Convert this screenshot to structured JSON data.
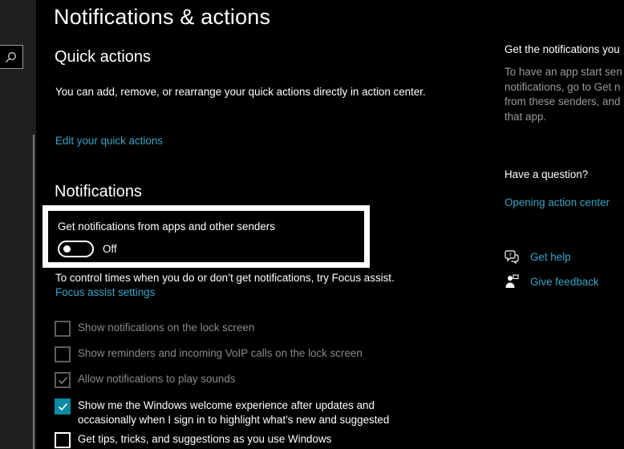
{
  "page_title": "Notifications & actions",
  "quick_actions": {
    "heading": "Quick actions",
    "description": "You can add, remove, or rearrange your quick actions directly in action center.",
    "edit_link": "Edit your quick actions"
  },
  "notifications": {
    "heading": "Notifications",
    "toggle_label": "Get notifications from apps and other senders",
    "toggle_state": "Off",
    "focus_text": "To control times when you do or don’t get notifications, try Focus assist.",
    "focus_link": "Focus assist settings",
    "options": [
      {
        "label": "Show notifications on the lock screen",
        "checked": false
      },
      {
        "label": "Show reminders and incoming VoIP calls on the lock screen",
        "checked": false
      },
      {
        "label": "Allow notifications to play sounds",
        "checked": true
      },
      {
        "label": "Show me the Windows welcome experience after updates and occasionally when I sign in to highlight what’s new and suggested",
        "checked": true
      },
      {
        "label": "Get tips, tricks, and suggestions as you use Windows",
        "checked": false
      }
    ]
  },
  "side": {
    "heading": "Get the notifications you",
    "text_lines": [
      "To have an app start sen",
      "notifications, go to Get n",
      "from these senders, and",
      "that app."
    ],
    "question_heading": "Have a question?",
    "question_link": "Opening action center",
    "help": {
      "get_help": "Get help",
      "give_feedback": "Give feedback"
    }
  },
  "colors": {
    "accent": "#0c8aa0",
    "link": "#3aa5c5",
    "background": "#000000"
  }
}
